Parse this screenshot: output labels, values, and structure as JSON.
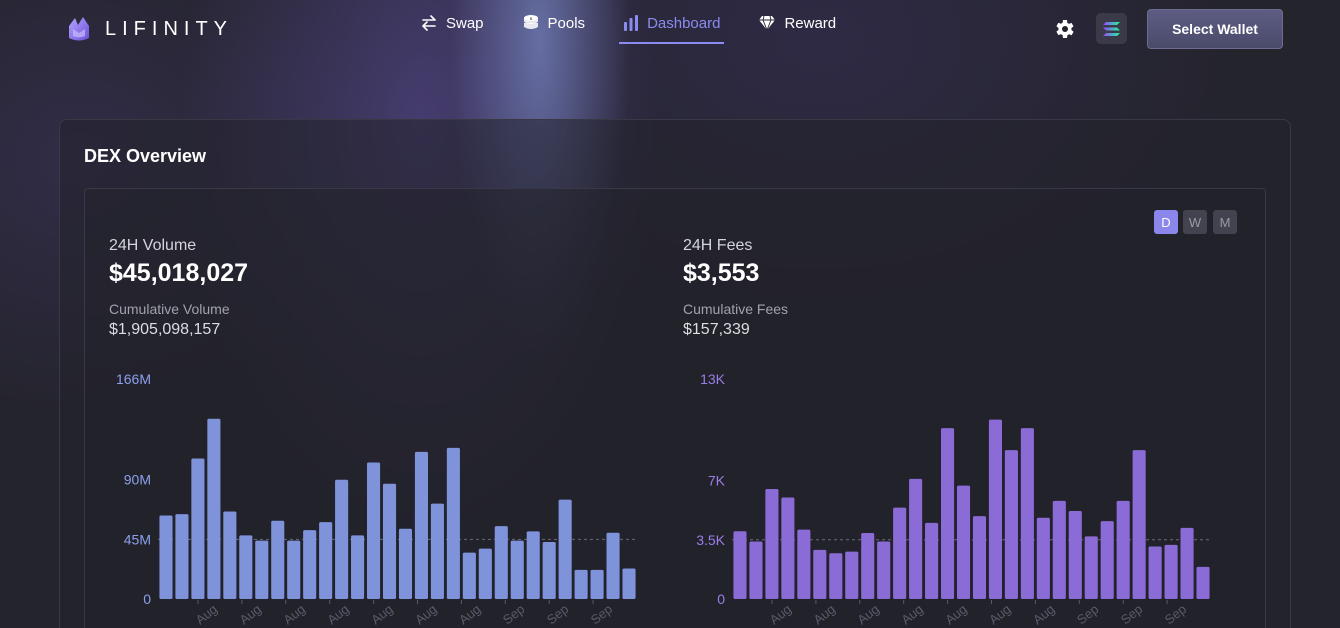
{
  "app": {
    "name": "LIFINITY"
  },
  "nav": [
    {
      "label": "Swap",
      "icon": "swap-arrows-icon",
      "active": false
    },
    {
      "label": "Pools",
      "icon": "coins-icon",
      "active": false
    },
    {
      "label": "Dashboard",
      "icon": "bar-chart-icon",
      "active": true
    },
    {
      "label": "Reward",
      "icon": "diamond-icon",
      "active": false
    }
  ],
  "header": {
    "settings_icon": "gear-icon",
    "network_icon": "solana-icon",
    "wallet_label": "Select Wallet"
  },
  "card": {
    "title": "DEX Overview"
  },
  "period_toggle": [
    {
      "label": "D",
      "active": true
    },
    {
      "label": "W",
      "active": false
    },
    {
      "label": "M",
      "active": false
    }
  ],
  "volume": {
    "label": "24H Volume",
    "value": "$45,018,027",
    "cumulative_label": "Cumulative Volume",
    "cumulative_value": "$1,905,098,157"
  },
  "fees": {
    "label": "24H Fees",
    "value": "$3,553",
    "cumulative_label": "Cumulative Fees",
    "cumulative_value": "$157,339"
  },
  "colors": {
    "accent": "#8b8cf0",
    "volume_bar": "#7f93db",
    "fees_bar": "#8b6bd6"
  },
  "chart_data": [
    {
      "type": "bar",
      "title": "",
      "ylim": [
        0,
        166
      ],
      "ylabel": "",
      "ytick_labels": [
        "0",
        "45M",
        "90M",
        "166M"
      ],
      "ytick_values": [
        0,
        45,
        90,
        166
      ],
      "avg_line": 45,
      "xtick_labels": [
        "Aug",
        "Aug",
        "Aug",
        "Aug",
        "Aug",
        "Aug",
        "Aug",
        "Sep",
        "Sep",
        "Sep"
      ],
      "values": [
        63,
        64,
        106,
        136,
        66,
        48,
        44,
        59,
        44,
        52,
        58,
        90,
        48,
        103,
        87,
        53,
        111,
        72,
        114,
        35,
        38,
        55,
        44,
        51,
        43,
        75,
        22,
        22,
        50,
        23
      ]
    },
    {
      "type": "bar",
      "title": "",
      "ylim": [
        0,
        13
      ],
      "ylabel": "",
      "ytick_labels": [
        "0",
        "3.5K",
        "7K",
        "13K"
      ],
      "ytick_values": [
        0,
        3.5,
        7,
        13
      ],
      "avg_line": 3.5,
      "xtick_labels": [
        "Aug",
        "Aug",
        "Aug",
        "Aug",
        "Aug",
        "Aug",
        "Aug",
        "Sep",
        "Sep",
        "Sep"
      ],
      "values": [
        4.0,
        3.4,
        6.5,
        6.0,
        4.1,
        2.9,
        2.7,
        2.8,
        3.9,
        3.4,
        5.4,
        7.1,
        4.5,
        10.1,
        6.7,
        4.9,
        10.6,
        8.8,
        10.1,
        4.8,
        5.8,
        5.2,
        3.7,
        4.6,
        5.8,
        8.8,
        3.1,
        3.2,
        4.2,
        1.9
      ]
    }
  ]
}
